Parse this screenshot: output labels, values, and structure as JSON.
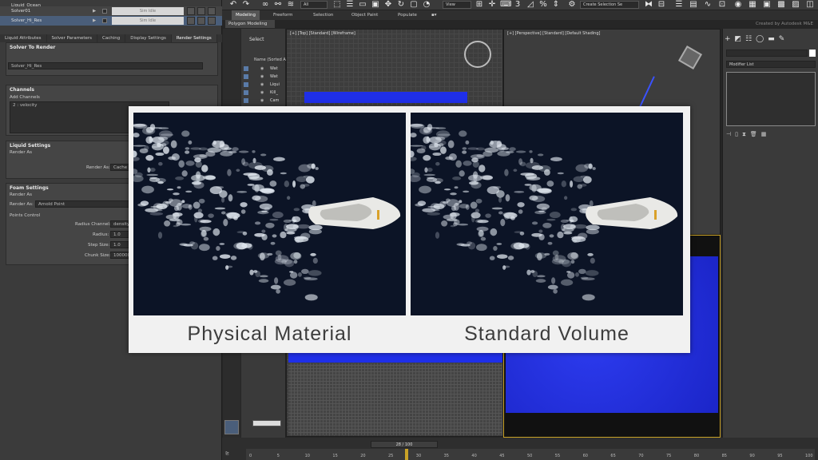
{
  "scene_tree": {
    "rows": [
      {
        "name": "Liquid_Ocean"
      },
      {
        "name": "Solver01",
        "field": "Sim Idle"
      },
      {
        "name": "Solver_Hi_Res",
        "field": "Sim Idle"
      }
    ]
  },
  "left_tabs": [
    "Liquid Attributes",
    "Solver Parameters",
    "Caching",
    "Display Settings",
    "Render Settings"
  ],
  "left_panel": {
    "solver_header": "Solver To Render",
    "solver_value": "Solver_Hi_Res",
    "channels_header": "Channels",
    "add_channels_label": "Add Channels",
    "channel_item": "2 : velocity",
    "liquid_header": "Liquid Settings",
    "liquid_render_as": "Render As",
    "liquid_render_as_label": "Render As:",
    "liquid_render_as_value": "Cache F",
    "foam_header": "Foam Settings",
    "foam_render_as": "Render As",
    "foam_render_as_label": "Render As:",
    "foam_render_as_value": "Arnold Point",
    "points_control": "Points Control",
    "radius_channel_label": "Radius Channel:",
    "radius_channel_value": "density",
    "radius_label": "Radius:",
    "radius_value": "1.0",
    "step_size_label": "Step Size:",
    "step_size_value": "1.0",
    "chunk_size_label": "Chunk Size:",
    "chunk_size_value": "100000"
  },
  "toolbar": {
    "filter_value": "All",
    "view_value": "View",
    "create_selection": "Create Selection Se"
  },
  "ribbon": {
    "tabs": [
      "Modeling",
      "Freeform",
      "Selection",
      "Object Paint",
      "Populate"
    ],
    "sub_label": "Polygon Modeling",
    "brand": "Created by Autodesk M&E"
  },
  "explorer": {
    "select_label": "Select",
    "header": "Name (Sorted A",
    "rows": [
      "Wat",
      "Wat",
      "Liqui",
      "Kill_",
      "Cam"
    ]
  },
  "viewports": {
    "top_caption": "[+] [Top] [Standard] [Wireframe]",
    "persp_caption": "[+] [Perspective] [Standard] [Default Shading]"
  },
  "command_panel": {
    "modifier_list": "Modifier List"
  },
  "timeline": {
    "frame_display": "28 / 100",
    "current_frame": 28,
    "total_frames": 100,
    "tick_labels": [
      "0",
      "5",
      "10",
      "15",
      "20",
      "25",
      "30",
      "35",
      "40",
      "45",
      "50",
      "55",
      "60",
      "65",
      "70",
      "75",
      "80",
      "85",
      "90",
      "95",
      "100"
    ]
  },
  "comparison": {
    "left_caption": "Physical Material",
    "right_caption": "Standard Volume"
  },
  "colors": {
    "liquid_blue": "#1f2fe8",
    "active_frame": "#c9a227",
    "ocean_dark": "#0c1426"
  }
}
